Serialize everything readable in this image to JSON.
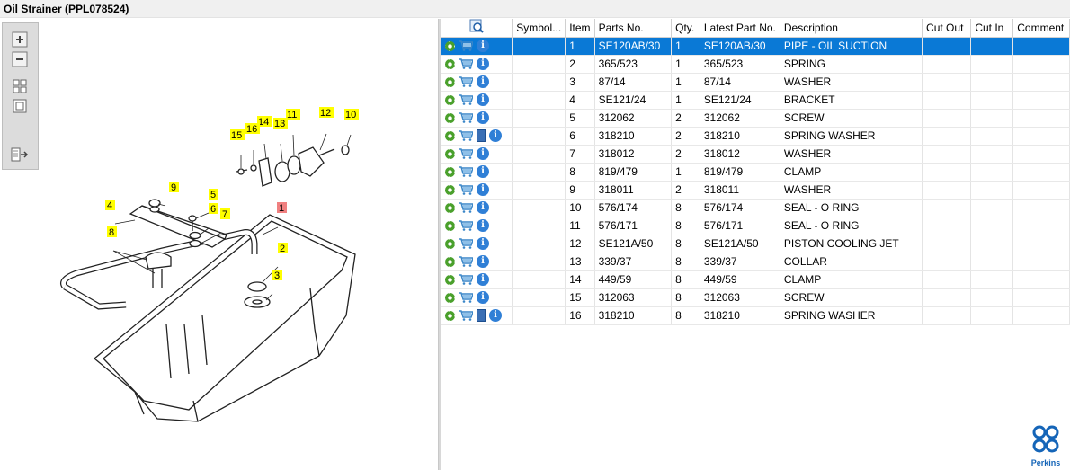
{
  "window": {
    "title": "Oil Strainer (PPL078524)"
  },
  "toolbar": {
    "buttons": [
      "zoom-in",
      "zoom-out",
      "fit-all",
      "actual-size",
      "export"
    ]
  },
  "diagram": {
    "callouts": [
      "1",
      "2",
      "3",
      "4",
      "5",
      "6",
      "7",
      "8",
      "9",
      "10",
      "11",
      "12",
      "13",
      "14",
      "15",
      "16"
    ],
    "highlighted_callout": "1",
    "highlight_color": "#f08080",
    "callout_color": "#ffff00"
  },
  "table": {
    "headers": {
      "view": "",
      "symbol": "Symbol...",
      "item": "Item",
      "parts_no": "Parts No.",
      "qty": "Qty.",
      "latest": "Latest Part No.",
      "description": "Description",
      "cut_out": "Cut Out",
      "cut_in": "Cut In",
      "comment": "Comment"
    },
    "rows": [
      {
        "item": "1",
        "parts_no": "SE120AB/30",
        "qty": "1",
        "latest": "SE120AB/30",
        "description": "PIPE - OIL SUCTION",
        "doc": false
      },
      {
        "item": "2",
        "parts_no": "365/523",
        "qty": "1",
        "latest": "365/523",
        "description": "SPRING",
        "doc": false
      },
      {
        "item": "3",
        "parts_no": "87/14",
        "qty": "1",
        "latest": "87/14",
        "description": "WASHER",
        "doc": false
      },
      {
        "item": "4",
        "parts_no": "SE121/24",
        "qty": "1",
        "latest": "SE121/24",
        "description": "BRACKET",
        "doc": false
      },
      {
        "item": "5",
        "parts_no": "312062",
        "qty": "2",
        "latest": "312062",
        "description": "SCREW",
        "doc": false
      },
      {
        "item": "6",
        "parts_no": "318210",
        "qty": "2",
        "latest": "318210",
        "description": "SPRING WASHER",
        "doc": true
      },
      {
        "item": "7",
        "parts_no": "318012",
        "qty": "2",
        "latest": "318012",
        "description": "WASHER",
        "doc": false
      },
      {
        "item": "8",
        "parts_no": "819/479",
        "qty": "1",
        "latest": "819/479",
        "description": "CLAMP",
        "doc": false
      },
      {
        "item": "9",
        "parts_no": "318011",
        "qty": "2",
        "latest": "318011",
        "description": "WASHER",
        "doc": false
      },
      {
        "item": "10",
        "parts_no": "576/174",
        "qty": "8",
        "latest": "576/174",
        "description": "SEAL - O RING",
        "doc": false
      },
      {
        "item": "11",
        "parts_no": "576/171",
        "qty": "8",
        "latest": "576/171",
        "description": "SEAL - O RING",
        "doc": false
      },
      {
        "item": "12",
        "parts_no": "SE121A/50",
        "qty": "8",
        "latest": "SE121A/50",
        "description": "PISTON COOLING JET",
        "doc": false
      },
      {
        "item": "13",
        "parts_no": "339/37",
        "qty": "8",
        "latest": "339/37",
        "description": "COLLAR",
        "doc": false
      },
      {
        "item": "14",
        "parts_no": "449/59",
        "qty": "8",
        "latest": "449/59",
        "description": "CLAMP",
        "doc": false
      },
      {
        "item": "15",
        "parts_no": "312063",
        "qty": "8",
        "latest": "312063",
        "description": "SCREW",
        "doc": false
      },
      {
        "item": "16",
        "parts_no": "318210",
        "qty": "8",
        "latest": "318210",
        "description": "SPRING WASHER",
        "doc": true
      }
    ],
    "selected_row": 0
  },
  "logo": {
    "text": "Perkins"
  },
  "colors": {
    "selection": "#0a79d6",
    "icon_green": "#4aa02c",
    "icon_blue": "#2f7fd6",
    "brand": "#1565b8"
  }
}
